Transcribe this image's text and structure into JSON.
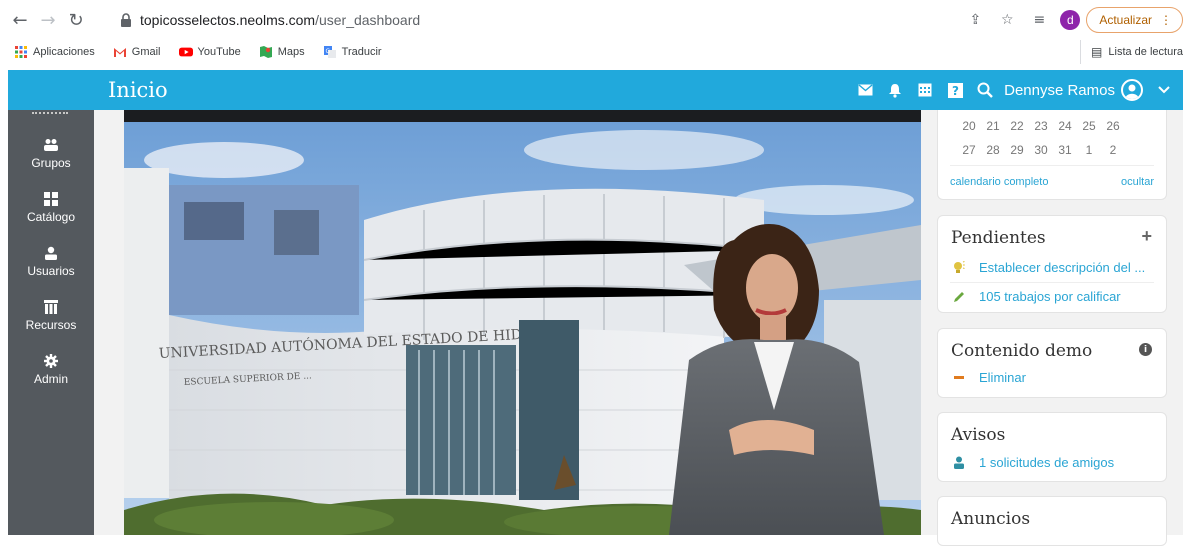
{
  "browser": {
    "url_domain": "topicosselectos.neolms.com",
    "url_path": "/user_dashboard",
    "update_label": "Actualizar",
    "profile_initial": "d",
    "bookmarks": [
      {
        "label": "Aplicaciones",
        "icon": "apps-grid-icon"
      },
      {
        "label": "Gmail",
        "icon": "gmail-icon"
      },
      {
        "label": "YouTube",
        "icon": "youtube-icon"
      },
      {
        "label": "Maps",
        "icon": "maps-icon"
      },
      {
        "label": "Traducir",
        "icon": "translate-icon"
      }
    ],
    "reading_list": "Lista de lectura"
  },
  "header": {
    "title": "Inicio",
    "user_name": "Dennyse Ramos",
    "accent_color": "#21a9dc"
  },
  "sidebar": {
    "items": [
      {
        "label": "Grupos",
        "icon": "groups-icon"
      },
      {
        "label": "Catálogo",
        "icon": "catalog-icon"
      },
      {
        "label": "Usuarios",
        "icon": "user-icon"
      },
      {
        "label": "Recursos",
        "icon": "resources-icon"
      },
      {
        "label": "Admin",
        "icon": "gear-icon"
      }
    ]
  },
  "calendar": {
    "row1": [
      "20",
      "21",
      "22",
      "23",
      "24",
      "25",
      "26"
    ],
    "row2": [
      "27",
      "28",
      "29",
      "30",
      "31",
      "1",
      "2"
    ],
    "full_link": "calendario completo",
    "hide_link": "ocultar"
  },
  "pendientes": {
    "title": "Pendientes",
    "add": "+",
    "items": [
      {
        "label": "Establecer descripción del ...",
        "icon": "bulb-icon"
      },
      {
        "label": "105 trabajos por calificar",
        "icon": "pencil-icon"
      }
    ]
  },
  "demo": {
    "title": "Contenido demo",
    "link": "Eliminar"
  },
  "avisos": {
    "title": "Avisos",
    "link": "1 solicitudes de amigos"
  },
  "anuncios": {
    "title": "Anuncios"
  }
}
